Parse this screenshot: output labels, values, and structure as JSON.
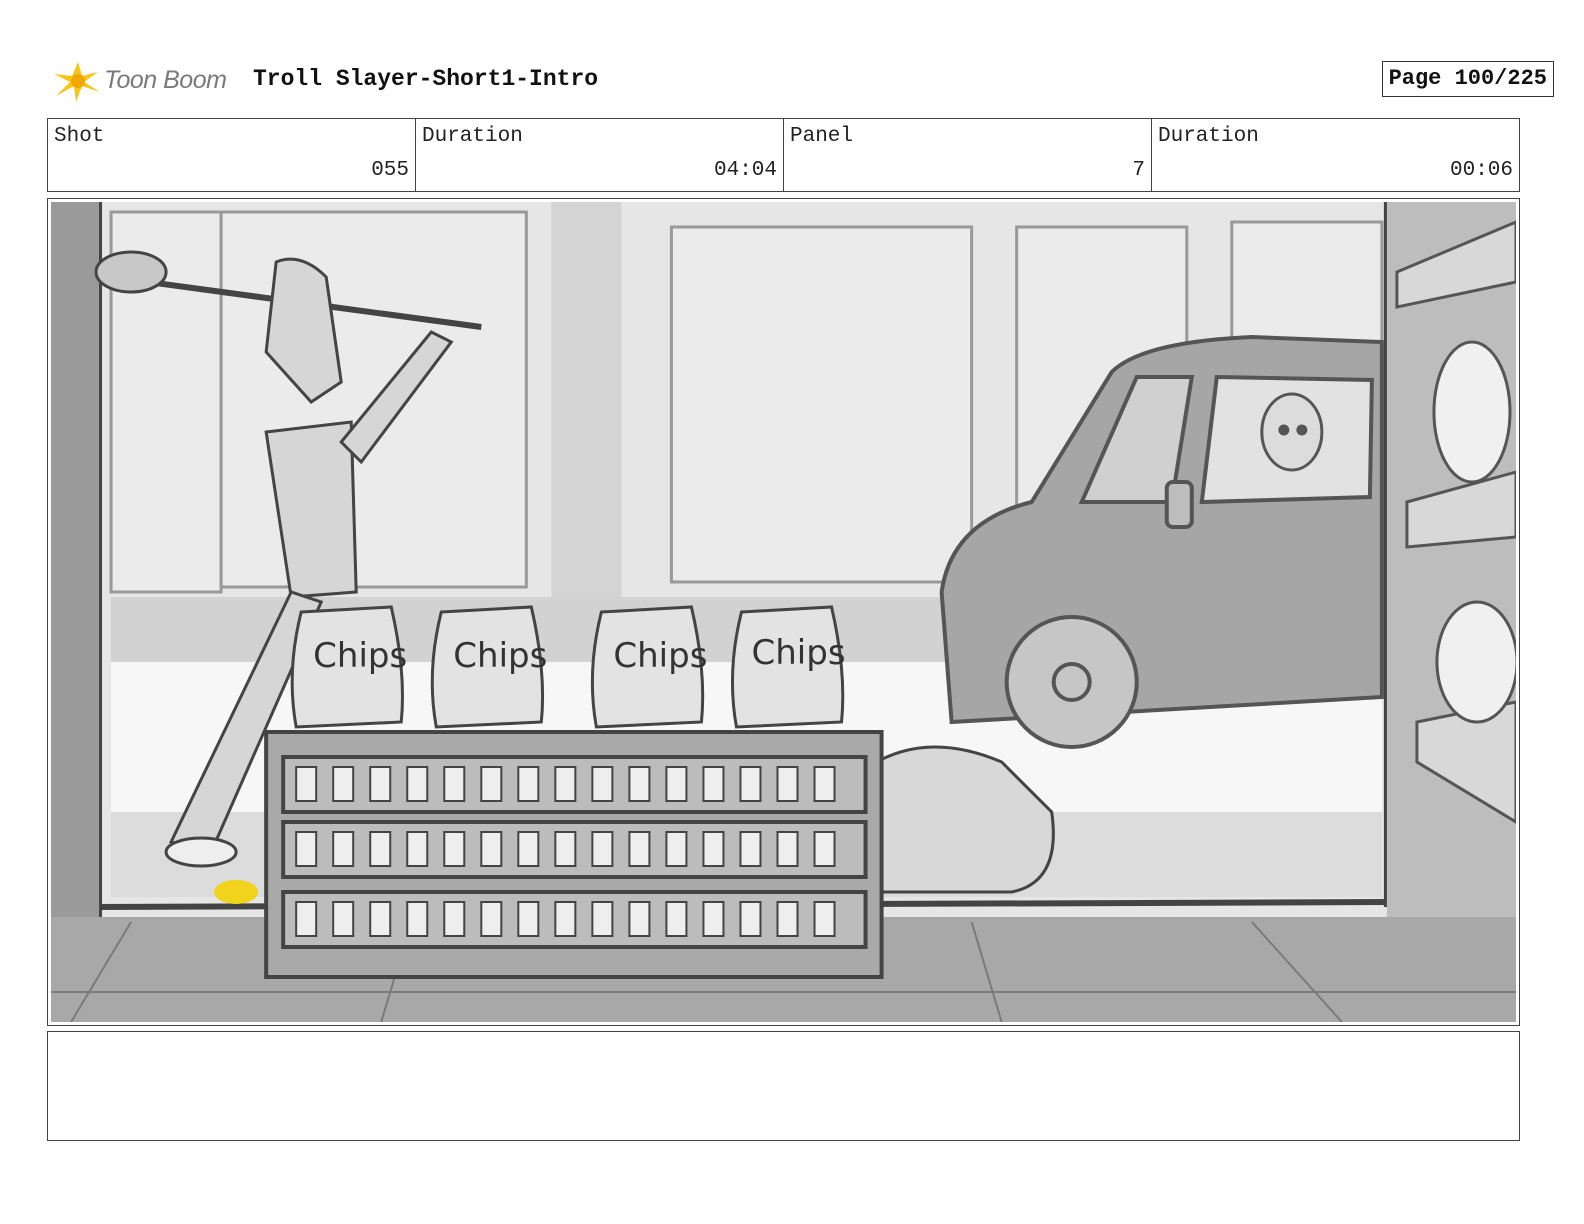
{
  "header": {
    "brand": "Toon Boom",
    "title": "Troll Slayer-Short1-Intro",
    "page": "Page 100/225"
  },
  "info": {
    "shot_label": "Shot",
    "shot_value": "055",
    "shot_duration_label": "Duration",
    "shot_duration_value": "04:04",
    "panel_label": "Panel",
    "panel_value": "7",
    "panel_duration_label": "Duration",
    "panel_duration_value": "00:06"
  },
  "panel": {
    "chip_bag_labels": [
      "Chips",
      "Chips",
      "Chips",
      "Chips"
    ]
  },
  "notes": {
    "text": ""
  },
  "colors": {
    "logo_yellow": "#f5c518",
    "sketch_gray": "#555555"
  }
}
